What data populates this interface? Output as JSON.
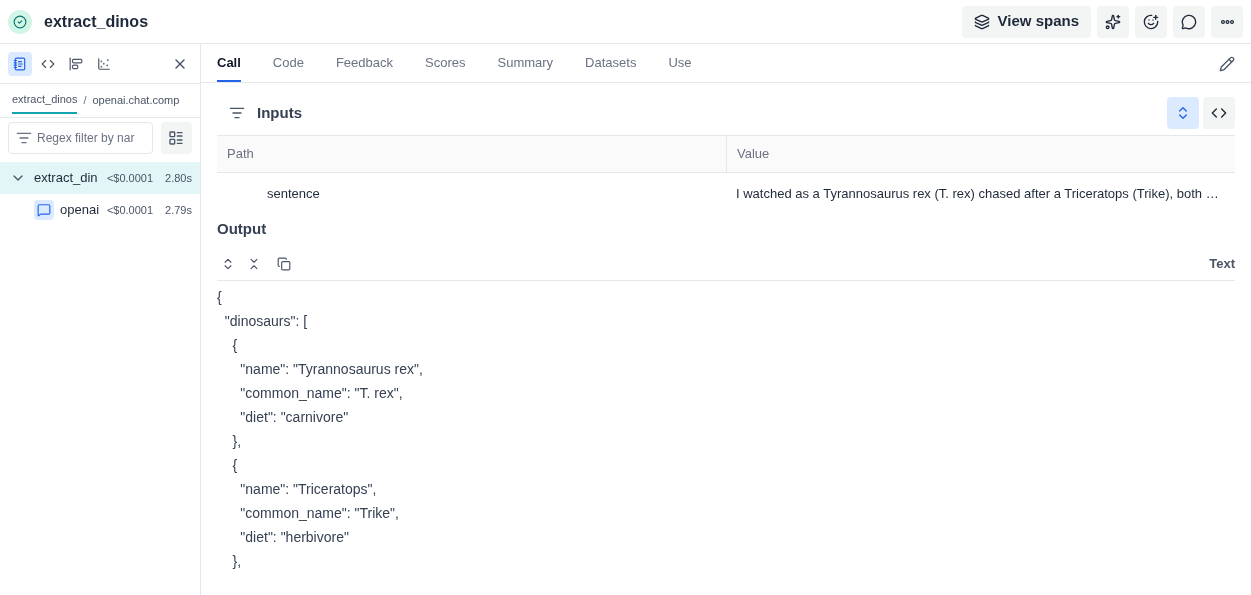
{
  "header": {
    "title": "extract_dinos",
    "buttons": [
      {
        "kind": "spans",
        "label": "View spans"
      },
      {
        "kind": "sparkle"
      },
      {
        "kind": "emoji"
      },
      {
        "kind": "comment"
      },
      {
        "kind": "more"
      }
    ]
  },
  "sidebar": {
    "views": [
      {
        "kind": "list",
        "selected": true
      },
      {
        "kind": "code",
        "selected": false
      },
      {
        "kind": "timeline",
        "selected": false
      },
      {
        "kind": "scatter",
        "selected": false
      }
    ],
    "breadcrumb_separator": "/",
    "breadcrumbs": [
      {
        "label": "extract_dinos",
        "selected": true
      },
      {
        "label": "openai.chat.comp",
        "selected": false
      }
    ],
    "filter": {
      "placeholder": "Regex filter by nar"
    },
    "tree": [
      {
        "name": "extract_din",
        "cost": "<$0.0001",
        "duration": "2.80s",
        "selected": true,
        "expanded": true,
        "children": [
          {
            "name": "openai",
            "cost": "<$0.0001",
            "duration": "2.79s",
            "selected": false
          }
        ]
      }
    ]
  },
  "tabs": [
    {
      "label": "Call",
      "selected": true
    },
    {
      "label": "Code",
      "selected": false
    },
    {
      "label": "Feedback",
      "selected": false
    },
    {
      "label": "Scores",
      "selected": false
    },
    {
      "label": "Summary",
      "selected": false
    },
    {
      "label": "Datasets",
      "selected": false
    },
    {
      "label": "Use",
      "selected": false
    }
  ],
  "inputs": {
    "title": "Inputs",
    "expand_selected": true,
    "columns": [
      "Path",
      "Value"
    ],
    "rows": [
      {
        "path": "sentence",
        "value": "I watched as a Tyrannosaurus rex (T. rex) chased after a Triceratops (Trike), both …"
      }
    ]
  },
  "output": {
    "title": "Output",
    "format": "Text",
    "lines": [
      "{",
      "  \"dinosaurs\": [",
      "    {",
      "      \"name\": \"Tyrannosaurus rex\",",
      "      \"common_name\": \"T. rex\",",
      "      \"diet\": \"carnivore\"",
      "    },",
      "    {",
      "      \"name\": \"Triceratops\",",
      "      \"common_name\": \"Trike\",",
      "      \"diet\": \"herbivore\"",
      "    },"
    ]
  }
}
